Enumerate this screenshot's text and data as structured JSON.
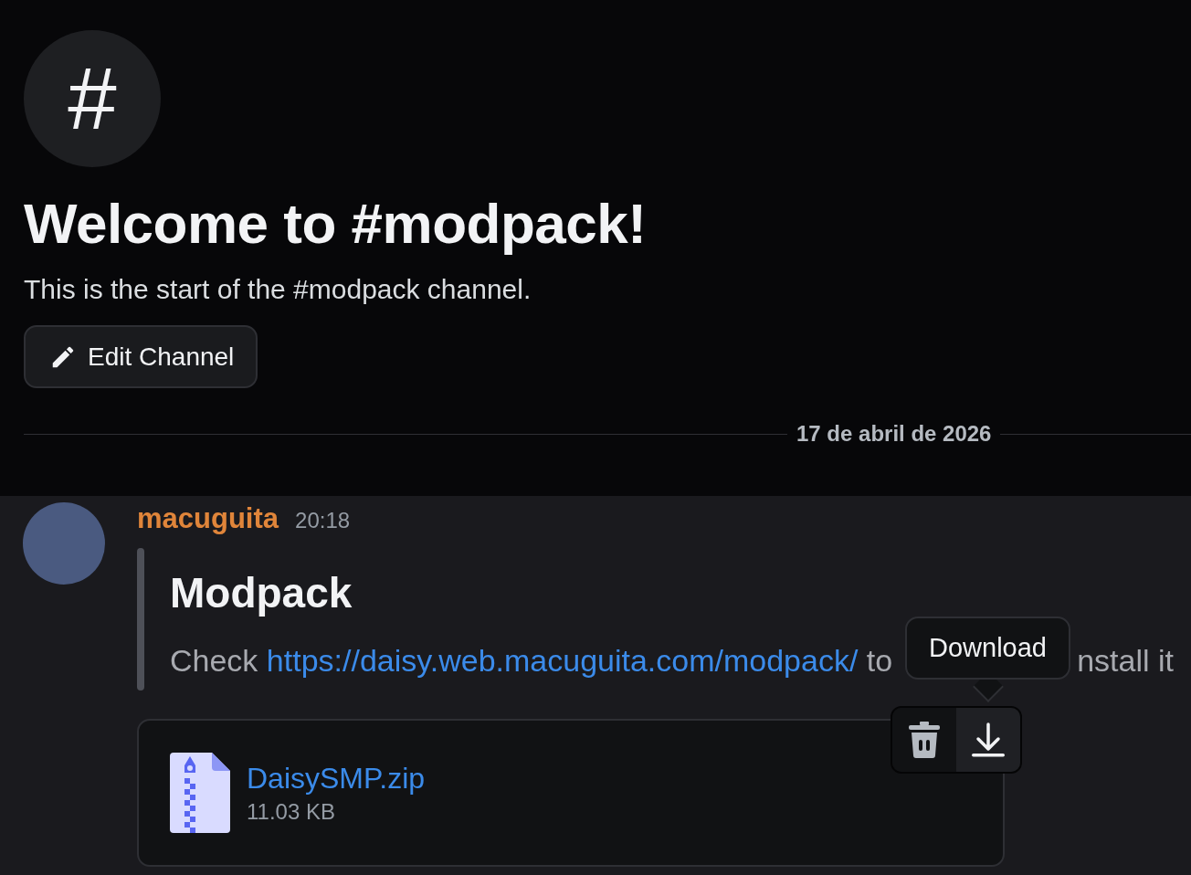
{
  "channel_intro": {
    "icon": "#",
    "title": "Welcome to #modpack!",
    "subtitle": "This is the start of the #modpack channel.",
    "edit_button": "Edit Channel"
  },
  "date_divider": "17 de abril de 2026",
  "message": {
    "author": "macuguita",
    "time": "20:18",
    "embed": {
      "title": "Modpack",
      "text_before": "Check ",
      "link": "https://daisy.web.macuguita.com/modpack/",
      "text_after": " to",
      "text_tail": "nstall it"
    },
    "attachment": {
      "file_name": "DaisySMP.zip",
      "file_size": "11.03 KB"
    },
    "tooltip": "Download"
  }
}
